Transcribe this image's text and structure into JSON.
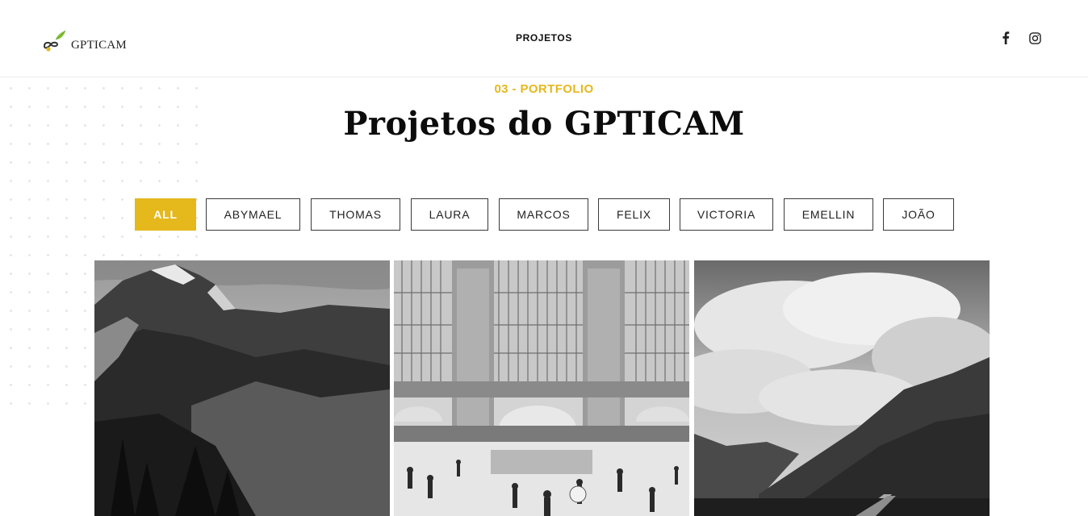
{
  "brand": {
    "name": "GPTICAM",
    "accent_color": "#e5b81c",
    "logo_icon": "leaf-infinity-logo-icon"
  },
  "nav": {
    "items": [
      {
        "label": "PROJETOS"
      }
    ]
  },
  "social": [
    {
      "icon": "facebook-icon"
    },
    {
      "icon": "instagram-icon"
    }
  ],
  "portfolio": {
    "eyebrow": "03 - PORTFOLIO",
    "title": "Projetos do GPTICAM",
    "filters": [
      {
        "label": "ALL",
        "active": true
      },
      {
        "label": "ABYMAEL",
        "active": false
      },
      {
        "label": "THOMAS",
        "active": false
      },
      {
        "label": "LAURA",
        "active": false
      },
      {
        "label": "MARCOS",
        "active": false
      },
      {
        "label": "FELIX",
        "active": false
      },
      {
        "label": "VICTORIA",
        "active": false
      },
      {
        "label": "EMELLIN",
        "active": false
      },
      {
        "label": "JOÃO",
        "active": false
      }
    ],
    "gallery": [
      {
        "image": "mountain-landscape-bw"
      },
      {
        "image": "grand-central-terminal-bw"
      },
      {
        "image": "cloudy-mountain-road-bw"
      }
    ]
  }
}
